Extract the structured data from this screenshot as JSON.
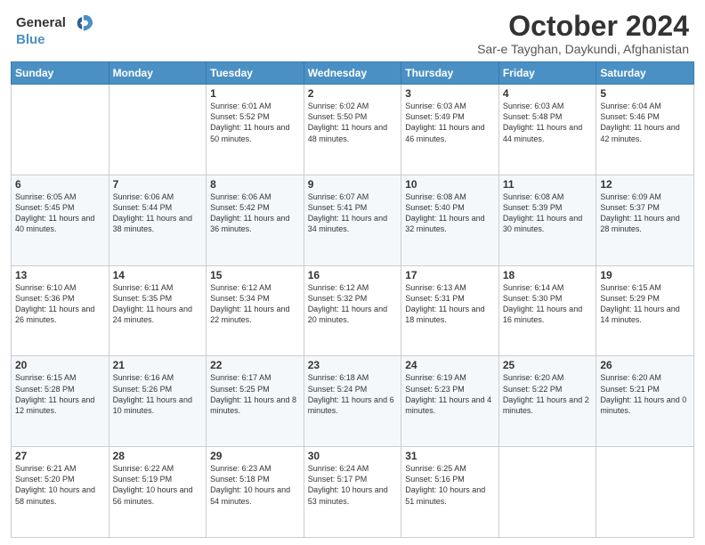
{
  "header": {
    "logo_line1": "General",
    "logo_line2": "Blue",
    "month": "October 2024",
    "location": "Sar-e Tayghan, Daykundi, Afghanistan"
  },
  "weekdays": [
    "Sunday",
    "Monday",
    "Tuesday",
    "Wednesday",
    "Thursday",
    "Friday",
    "Saturday"
  ],
  "weeks": [
    [
      {
        "day": "",
        "sunrise": "",
        "sunset": "",
        "daylight": ""
      },
      {
        "day": "",
        "sunrise": "",
        "sunset": "",
        "daylight": ""
      },
      {
        "day": "1",
        "sunrise": "Sunrise: 6:01 AM",
        "sunset": "Sunset: 5:52 PM",
        "daylight": "Daylight: 11 hours and 50 minutes."
      },
      {
        "day": "2",
        "sunrise": "Sunrise: 6:02 AM",
        "sunset": "Sunset: 5:50 PM",
        "daylight": "Daylight: 11 hours and 48 minutes."
      },
      {
        "day": "3",
        "sunrise": "Sunrise: 6:03 AM",
        "sunset": "Sunset: 5:49 PM",
        "daylight": "Daylight: 11 hours and 46 minutes."
      },
      {
        "day": "4",
        "sunrise": "Sunrise: 6:03 AM",
        "sunset": "Sunset: 5:48 PM",
        "daylight": "Daylight: 11 hours and 44 minutes."
      },
      {
        "day": "5",
        "sunrise": "Sunrise: 6:04 AM",
        "sunset": "Sunset: 5:46 PM",
        "daylight": "Daylight: 11 hours and 42 minutes."
      }
    ],
    [
      {
        "day": "6",
        "sunrise": "Sunrise: 6:05 AM",
        "sunset": "Sunset: 5:45 PM",
        "daylight": "Daylight: 11 hours and 40 minutes."
      },
      {
        "day": "7",
        "sunrise": "Sunrise: 6:06 AM",
        "sunset": "Sunset: 5:44 PM",
        "daylight": "Daylight: 11 hours and 38 minutes."
      },
      {
        "day": "8",
        "sunrise": "Sunrise: 6:06 AM",
        "sunset": "Sunset: 5:42 PM",
        "daylight": "Daylight: 11 hours and 36 minutes."
      },
      {
        "day": "9",
        "sunrise": "Sunrise: 6:07 AM",
        "sunset": "Sunset: 5:41 PM",
        "daylight": "Daylight: 11 hours and 34 minutes."
      },
      {
        "day": "10",
        "sunrise": "Sunrise: 6:08 AM",
        "sunset": "Sunset: 5:40 PM",
        "daylight": "Daylight: 11 hours and 32 minutes."
      },
      {
        "day": "11",
        "sunrise": "Sunrise: 6:08 AM",
        "sunset": "Sunset: 5:39 PM",
        "daylight": "Daylight: 11 hours and 30 minutes."
      },
      {
        "day": "12",
        "sunrise": "Sunrise: 6:09 AM",
        "sunset": "Sunset: 5:37 PM",
        "daylight": "Daylight: 11 hours and 28 minutes."
      }
    ],
    [
      {
        "day": "13",
        "sunrise": "Sunrise: 6:10 AM",
        "sunset": "Sunset: 5:36 PM",
        "daylight": "Daylight: 11 hours and 26 minutes."
      },
      {
        "day": "14",
        "sunrise": "Sunrise: 6:11 AM",
        "sunset": "Sunset: 5:35 PM",
        "daylight": "Daylight: 11 hours and 24 minutes."
      },
      {
        "day": "15",
        "sunrise": "Sunrise: 6:12 AM",
        "sunset": "Sunset: 5:34 PM",
        "daylight": "Daylight: 11 hours and 22 minutes."
      },
      {
        "day": "16",
        "sunrise": "Sunrise: 6:12 AM",
        "sunset": "Sunset: 5:32 PM",
        "daylight": "Daylight: 11 hours and 20 minutes."
      },
      {
        "day": "17",
        "sunrise": "Sunrise: 6:13 AM",
        "sunset": "Sunset: 5:31 PM",
        "daylight": "Daylight: 11 hours and 18 minutes."
      },
      {
        "day": "18",
        "sunrise": "Sunrise: 6:14 AM",
        "sunset": "Sunset: 5:30 PM",
        "daylight": "Daylight: 11 hours and 16 minutes."
      },
      {
        "day": "19",
        "sunrise": "Sunrise: 6:15 AM",
        "sunset": "Sunset: 5:29 PM",
        "daylight": "Daylight: 11 hours and 14 minutes."
      }
    ],
    [
      {
        "day": "20",
        "sunrise": "Sunrise: 6:15 AM",
        "sunset": "Sunset: 5:28 PM",
        "daylight": "Daylight: 11 hours and 12 minutes."
      },
      {
        "day": "21",
        "sunrise": "Sunrise: 6:16 AM",
        "sunset": "Sunset: 5:26 PM",
        "daylight": "Daylight: 11 hours and 10 minutes."
      },
      {
        "day": "22",
        "sunrise": "Sunrise: 6:17 AM",
        "sunset": "Sunset: 5:25 PM",
        "daylight": "Daylight: 11 hours and 8 minutes."
      },
      {
        "day": "23",
        "sunrise": "Sunrise: 6:18 AM",
        "sunset": "Sunset: 5:24 PM",
        "daylight": "Daylight: 11 hours and 6 minutes."
      },
      {
        "day": "24",
        "sunrise": "Sunrise: 6:19 AM",
        "sunset": "Sunset: 5:23 PM",
        "daylight": "Daylight: 11 hours and 4 minutes."
      },
      {
        "day": "25",
        "sunrise": "Sunrise: 6:20 AM",
        "sunset": "Sunset: 5:22 PM",
        "daylight": "Daylight: 11 hours and 2 minutes."
      },
      {
        "day": "26",
        "sunrise": "Sunrise: 6:20 AM",
        "sunset": "Sunset: 5:21 PM",
        "daylight": "Daylight: 11 hours and 0 minutes."
      }
    ],
    [
      {
        "day": "27",
        "sunrise": "Sunrise: 6:21 AM",
        "sunset": "Sunset: 5:20 PM",
        "daylight": "Daylight: 10 hours and 58 minutes."
      },
      {
        "day": "28",
        "sunrise": "Sunrise: 6:22 AM",
        "sunset": "Sunset: 5:19 PM",
        "daylight": "Daylight: 10 hours and 56 minutes."
      },
      {
        "day": "29",
        "sunrise": "Sunrise: 6:23 AM",
        "sunset": "Sunset: 5:18 PM",
        "daylight": "Daylight: 10 hours and 54 minutes."
      },
      {
        "day": "30",
        "sunrise": "Sunrise: 6:24 AM",
        "sunset": "Sunset: 5:17 PM",
        "daylight": "Daylight: 10 hours and 53 minutes."
      },
      {
        "day": "31",
        "sunrise": "Sunrise: 6:25 AM",
        "sunset": "Sunset: 5:16 PM",
        "daylight": "Daylight: 10 hours and 51 minutes."
      },
      {
        "day": "",
        "sunrise": "",
        "sunset": "",
        "daylight": ""
      },
      {
        "day": "",
        "sunrise": "",
        "sunset": "",
        "daylight": ""
      }
    ]
  ]
}
